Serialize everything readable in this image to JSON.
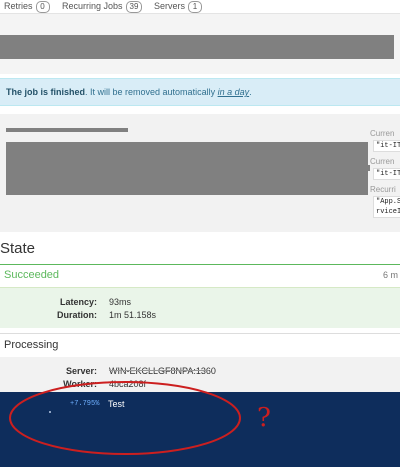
{
  "nav": {
    "items": [
      {
        "label": "Retries",
        "count": "0"
      },
      {
        "label": "Recurring Jobs",
        "count": "39"
      },
      {
        "label": "Servers",
        "count": "1"
      }
    ]
  },
  "notice": {
    "bold": "The job is finished",
    "text": ". It will be removed automatically ",
    "link": "in a day",
    "end": "."
  },
  "job": {
    "code_line": ", ,  , , , , ,    ,  ,  , ,  ,  . ,  ,",
    "side": {
      "current_label_1": "Curren",
      "current_value_1": "\"it-IT",
      "current_label_2": "Curren",
      "current_value_2": "\"it-IT",
      "recurring_label": "Recurri",
      "recurring_value_1": "\"App.S",
      "recurring_value_2": "rviceI"
    }
  },
  "state": {
    "title": "State",
    "succeeded": {
      "label": "Succeeded",
      "time": "6 m",
      "latency_key": "Latency:",
      "latency_val": "93ms",
      "duration_key": "Duration:",
      "duration_val": "1m 51.158s"
    },
    "processing": {
      "label": "Processing",
      "server_key": "Server:",
      "server_val": "WIN-EKCLLGF8NPA:1360",
      "worker_key": "Worker:",
      "worker_val": "4bca208f"
    }
  },
  "console": {
    "percent": "+7.795%",
    "message": "Test"
  },
  "annotation": {
    "mark": "?",
    "color": "#cc1f1f"
  }
}
